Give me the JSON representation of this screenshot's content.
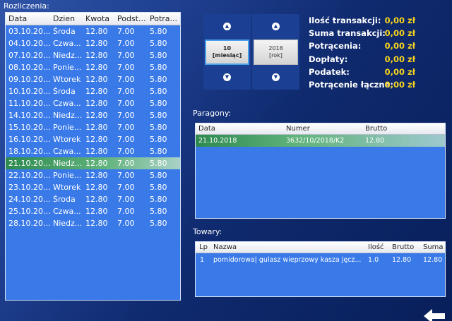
{
  "rozliczenia": {
    "title": "Rozliczenia:",
    "columns": [
      "Data",
      "Dzien",
      "Kwota",
      "Podst...",
      "Potra..."
    ],
    "selected_index": 11,
    "rows": [
      [
        "03.10.20...",
        "Środa",
        "12.80",
        "7.00",
        "5.80"
      ],
      [
        "04.10.20...",
        "Czwa...",
        "12.80",
        "7.00",
        "5.80"
      ],
      [
        "07.10.20...",
        "Niedz...",
        "12.80",
        "7.00",
        "5.80"
      ],
      [
        "08.10.20...",
        "Ponie...",
        "12.80",
        "7.00",
        "5.80"
      ],
      [
        "09.10.20...",
        "Wtorek",
        "12.80",
        "7.00",
        "5.80"
      ],
      [
        "10.10.20...",
        "Środa",
        "12.80",
        "7.00",
        "5.80"
      ],
      [
        "11.10.20...",
        "Czwa...",
        "12.80",
        "7.00",
        "5.80"
      ],
      [
        "14.10.20...",
        "Niedz...",
        "12.80",
        "7.00",
        "5.80"
      ],
      [
        "15.10.20...",
        "Ponie...",
        "12.80",
        "7.00",
        "5.80"
      ],
      [
        "16.10.20...",
        "Wtorek",
        "12.80",
        "7.00",
        "5.80"
      ],
      [
        "18.10.20...",
        "Czwa...",
        "12.80",
        "7.00",
        "5.80"
      ],
      [
        "21.10.20...",
        "Niedz...",
        "12.80",
        "7.00",
        "5.80"
      ],
      [
        "22.10.20...",
        "Ponie...",
        "12.80",
        "7.00",
        "5.80"
      ],
      [
        "23.10.20...",
        "Wtorek",
        "12.80",
        "7.00",
        "5.80"
      ],
      [
        "24.10.20...",
        "Środa",
        "12.80",
        "7.00",
        "5.80"
      ],
      [
        "25.10.20...",
        "Czwa...",
        "12.80",
        "7.00",
        "5.80"
      ],
      [
        "28.10.20...",
        "Niedz...",
        "12.80",
        "7.00",
        "5.80"
      ]
    ]
  },
  "month_picker": {
    "value": "10",
    "label": "[miesiąc]",
    "up_icon": "chevron-up-icon",
    "down_icon": "chevron-down-icon"
  },
  "year_picker": {
    "value": "2018",
    "label": "[rok]",
    "up_icon": "chevron-up-icon",
    "down_icon": "chevron-down-icon"
  },
  "summary": {
    "ilosc_label": "Ilość transakcji:",
    "ilosc_value": "0,00 zł",
    "suma_label": "Suma transakcji:",
    "suma_value": "0,00 zł",
    "potracenia_label": "Potrącenia:",
    "potracenia_value": "0,00 zł",
    "doplaty_label": "Dopłaty:",
    "doplaty_value": "0,00 zł",
    "podatek_label": "Podatek:",
    "podatek_value": "0,00 zł",
    "lacznie_label": "Potrącenie łączne:",
    "lacznie_value": "0,00 zł"
  },
  "paragony": {
    "title": "Paragony:",
    "col_data": "Data",
    "col_numer": "Numer",
    "col_brutto": "Brutto",
    "row_data": "21.10.2018",
    "row_numer": "3632/10/2018/K2",
    "row_brutto": "12.80"
  },
  "towary": {
    "title": "Towary:",
    "col_lp": "Lp",
    "col_nazwa": "Nazwa",
    "col_ilosc": "Ilość",
    "col_brutto": "Brutto",
    "col_suma": "Suma",
    "row_lp": "1",
    "row_nazwa": "pomidorowa| gulasz wieprzowy kasza jęcz...",
    "row_ilosc": "1.0",
    "row_brutto": "12.80",
    "row_suma": "12.80"
  },
  "back_icon": "back-arrow-icon",
  "colors": {
    "panel": "#3a7ae8",
    "accent_value": "#f8d41c",
    "selected_row": "#2d8a4f"
  }
}
